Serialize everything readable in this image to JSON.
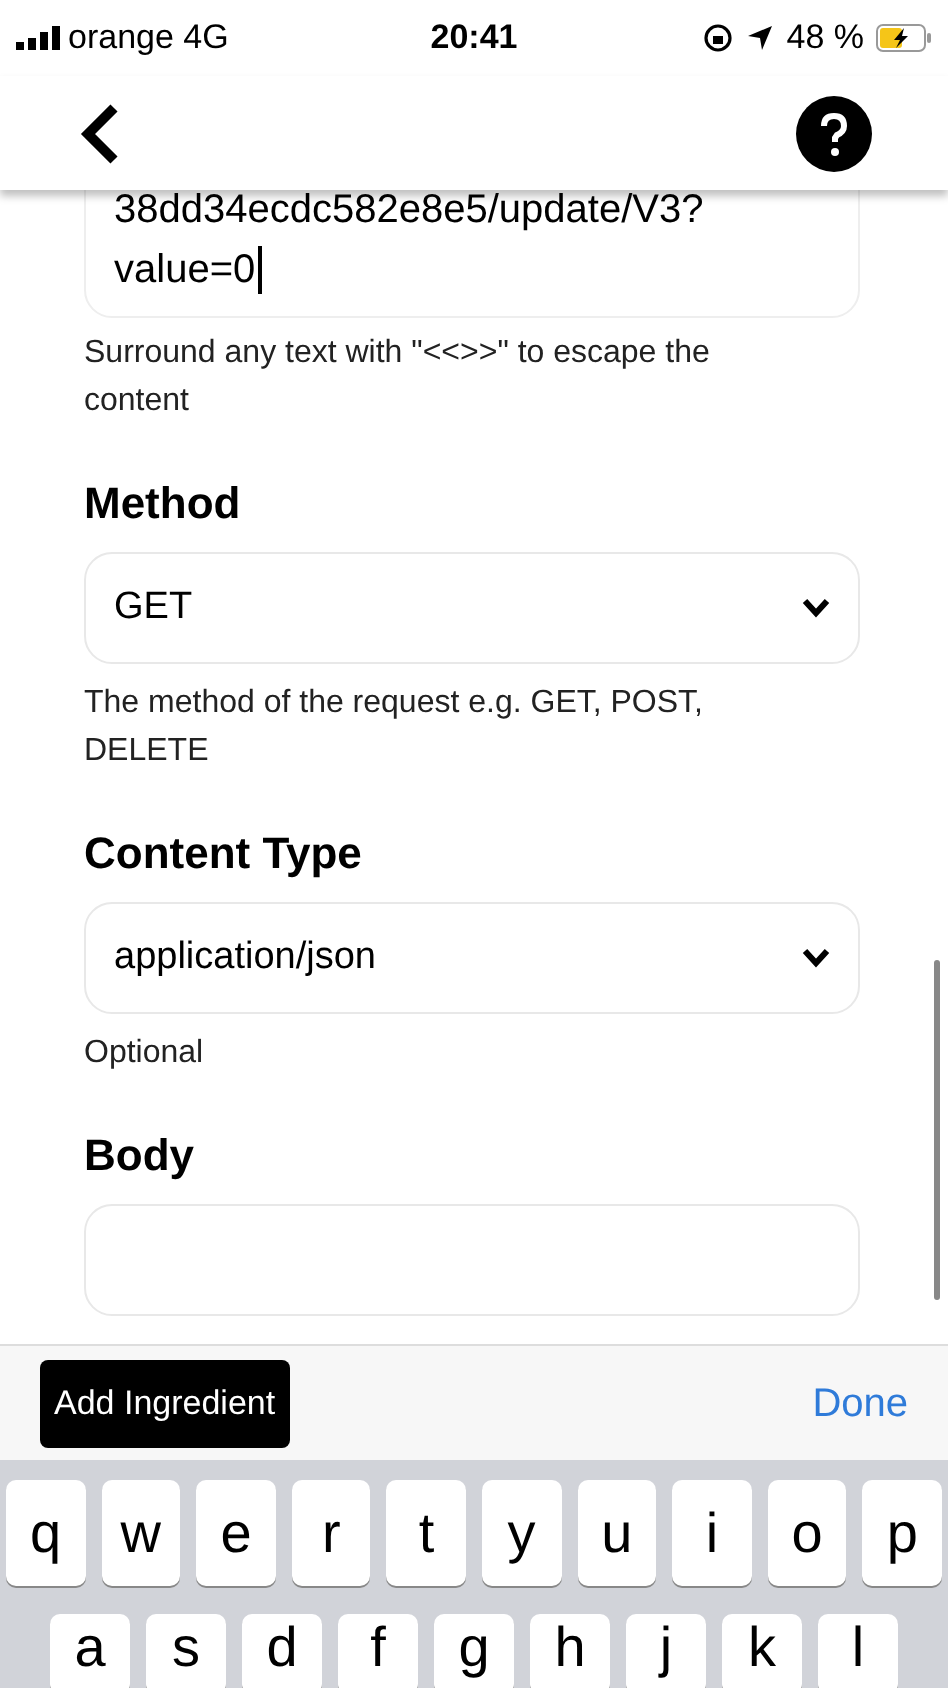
{
  "status_bar": {
    "carrier": "orange 4G",
    "time": "20:41",
    "battery": "48 %",
    "charging": true
  },
  "url_field": {
    "value_lines": [
      "38dd34ecdc582e8e5/update/V3?",
      "value=0"
    ],
    "hint": "Surround any text with \"<<>>\" to escape the content"
  },
  "fields": [
    {
      "kind": "select",
      "label": "Method",
      "value": "GET",
      "hint": "The method of the request e.g. GET, POST, DELETE"
    },
    {
      "kind": "select",
      "label": "Content Type",
      "value": "application/json",
      "hint": "Optional"
    },
    {
      "kind": "text",
      "label": "Body"
    }
  ],
  "toolbar": {
    "add_button": "Add Ingredient",
    "done_button": "Done"
  },
  "keyboard": {
    "rows": [
      [
        "q",
        "w",
        "e",
        "r",
        "t",
        "y",
        "u",
        "i",
        "o",
        "p"
      ],
      [
        "a",
        "s",
        "d",
        "f",
        "g",
        "h",
        "j",
        "k",
        "l"
      ]
    ]
  }
}
